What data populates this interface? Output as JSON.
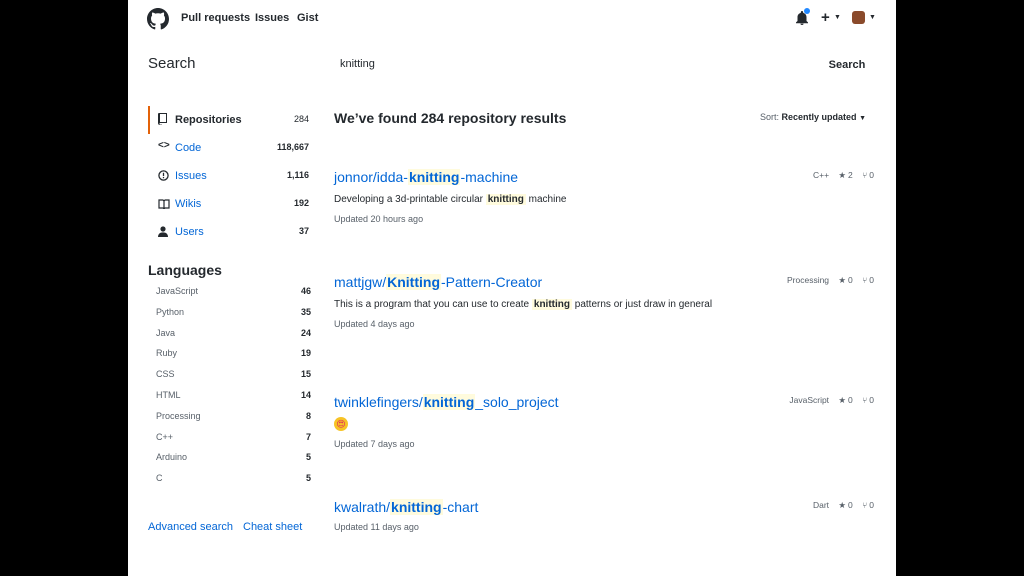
{
  "header": {
    "nav": [
      "Pull requests",
      "Issues",
      "Gist"
    ],
    "icons": [
      "github-logo-icon",
      "bell-icon",
      "plus-icon",
      "avatar"
    ]
  },
  "search": {
    "title": "Search",
    "query": "knitting",
    "button": "Search"
  },
  "sidebar": {
    "menu": [
      {
        "label": "Repositories",
        "count": "284",
        "icon": "repo-icon",
        "selected": true
      },
      {
        "label": "Code",
        "count": "118,667",
        "icon": "code-icon",
        "selected": false
      },
      {
        "label": "Issues",
        "count": "1,116",
        "icon": "issue-icon",
        "selected": false
      },
      {
        "label": "Wikis",
        "count": "192",
        "icon": "book-icon",
        "selected": false
      },
      {
        "label": "Users",
        "count": "37",
        "icon": "person-icon",
        "selected": false
      }
    ],
    "languages_title": "Languages",
    "languages": [
      {
        "name": "JavaScript",
        "count": "46"
      },
      {
        "name": "Python",
        "count": "35"
      },
      {
        "name": "Java",
        "count": "24"
      },
      {
        "name": "Ruby",
        "count": "19"
      },
      {
        "name": "CSS",
        "count": "15"
      },
      {
        "name": "HTML",
        "count": "14"
      },
      {
        "name": "Processing",
        "count": "8"
      },
      {
        "name": "C++",
        "count": "7"
      },
      {
        "name": "Arduino",
        "count": "5"
      },
      {
        "name": "C",
        "count": "5"
      }
    ],
    "advanced_search": "Advanced search",
    "cheat_sheet": "Cheat sheet"
  },
  "results": {
    "heading": "We’ve found 284 repository results",
    "sort_label": "Sort:",
    "sort_value": "Recently updated",
    "items": [
      {
        "title_prefix": "jonnor/idda-",
        "title_highlight": "knitting",
        "title_suffix": "-machine",
        "desc_prefix": "Developing a 3d-printable circular ",
        "desc_highlight": "knitting",
        "desc_suffix": " machine",
        "updated": "Updated 20 hours ago",
        "language": "C++",
        "stars": "2",
        "forks": "0"
      },
      {
        "title_prefix": "mattjgw/",
        "title_highlight": "Knitting",
        "title_suffix": "-Pattern-Creator",
        "desc_prefix": "This is a program that you can use to create ",
        "desc_highlight": "knitting",
        "desc_suffix": " patterns or just draw in general",
        "updated": "Updated 4 days ago",
        "language": "Processing",
        "stars": "0",
        "forks": "0"
      },
      {
        "title_prefix": "twinklefingers/",
        "title_highlight": "knitting",
        "title_suffix": "_solo_project",
        "desc_emoji": "😍",
        "updated": "Updated 7 days ago",
        "language": "JavaScript",
        "stars": "0",
        "forks": "0"
      },
      {
        "title_prefix": "kwalrath/",
        "title_highlight": "knitting",
        "title_suffix": "-chart",
        "updated": "Updated 11 days ago",
        "language": "Dart",
        "stars": "0",
        "forks": "0"
      }
    ]
  },
  "colors": {
    "accent": "#0366d6",
    "selected_border": "#e36209",
    "highlight": "#fffbdd"
  }
}
